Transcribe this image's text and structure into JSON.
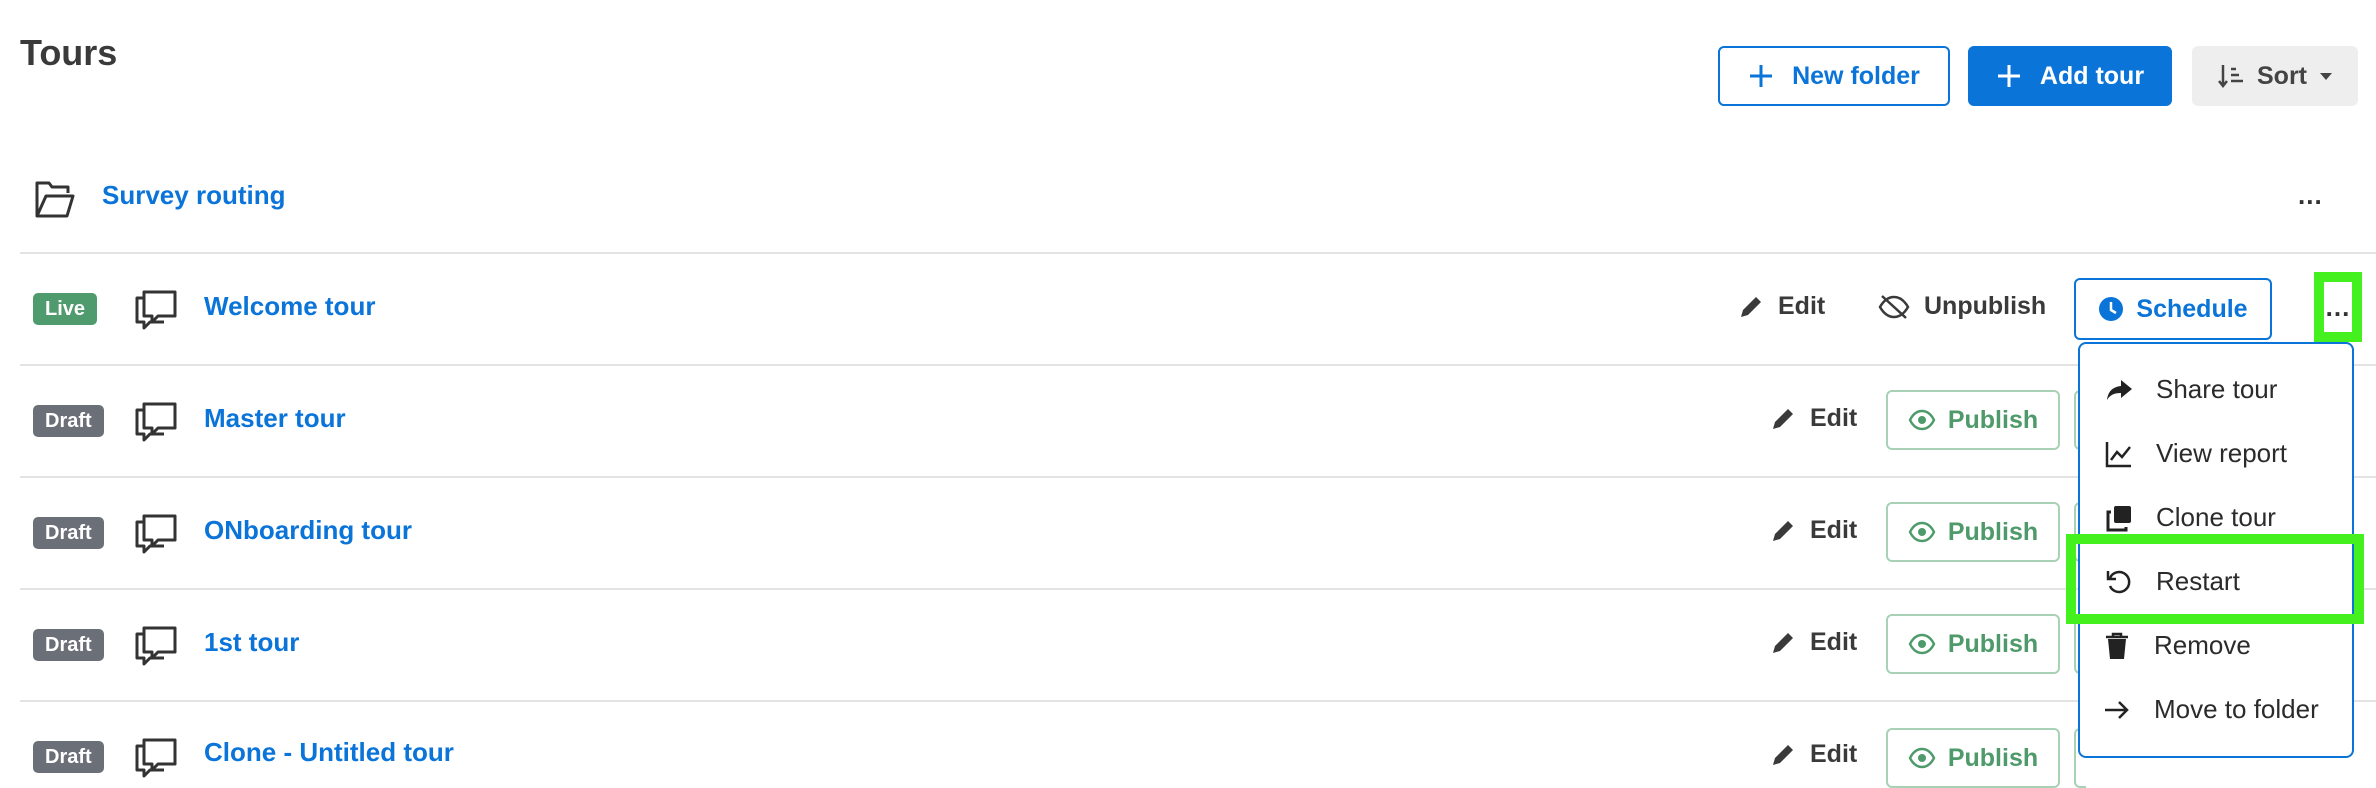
{
  "page": {
    "title": "Tours"
  },
  "toolbar": {
    "new_folder_label": "New folder",
    "add_tour_label": "Add tour",
    "sort_label": "Sort"
  },
  "folder": {
    "name": "Survey routing",
    "more_label": "..."
  },
  "tours": [
    {
      "status": "Live",
      "name": "Welcome tour",
      "edit_label": "Edit",
      "unpublish_label": "Unpublish",
      "schedule_label": "Schedule",
      "more_label": "..."
    },
    {
      "status": "Draft",
      "name": "Master tour",
      "edit_label": "Edit",
      "publish_label": "Publish"
    },
    {
      "status": "Draft",
      "name": "ONboarding tour",
      "edit_label": "Edit",
      "publish_label": "Publish"
    },
    {
      "status": "Draft",
      "name": "1st tour",
      "edit_label": "Edit",
      "publish_label": "Publish"
    },
    {
      "status": "Draft",
      "name": "Clone - Untitled tour",
      "edit_label": "Edit",
      "publish_label": "Publish"
    }
  ],
  "context_menu": {
    "items": [
      {
        "label": "Share tour",
        "icon": "share-icon"
      },
      {
        "label": "View report",
        "icon": "chart-line-icon"
      },
      {
        "label": "Clone tour",
        "icon": "clone-icon"
      },
      {
        "label": "Restart",
        "icon": "restart-icon"
      },
      {
        "label": "Remove",
        "icon": "trash-icon"
      },
      {
        "label": "Move to folder",
        "icon": "arrow-right-icon"
      }
    ]
  },
  "colors": {
    "accent": "#0b74d9",
    "live": "#4f9b6e",
    "draft": "#6b7078",
    "publish": "#4e9a6a",
    "highlight": "#44f01e"
  }
}
